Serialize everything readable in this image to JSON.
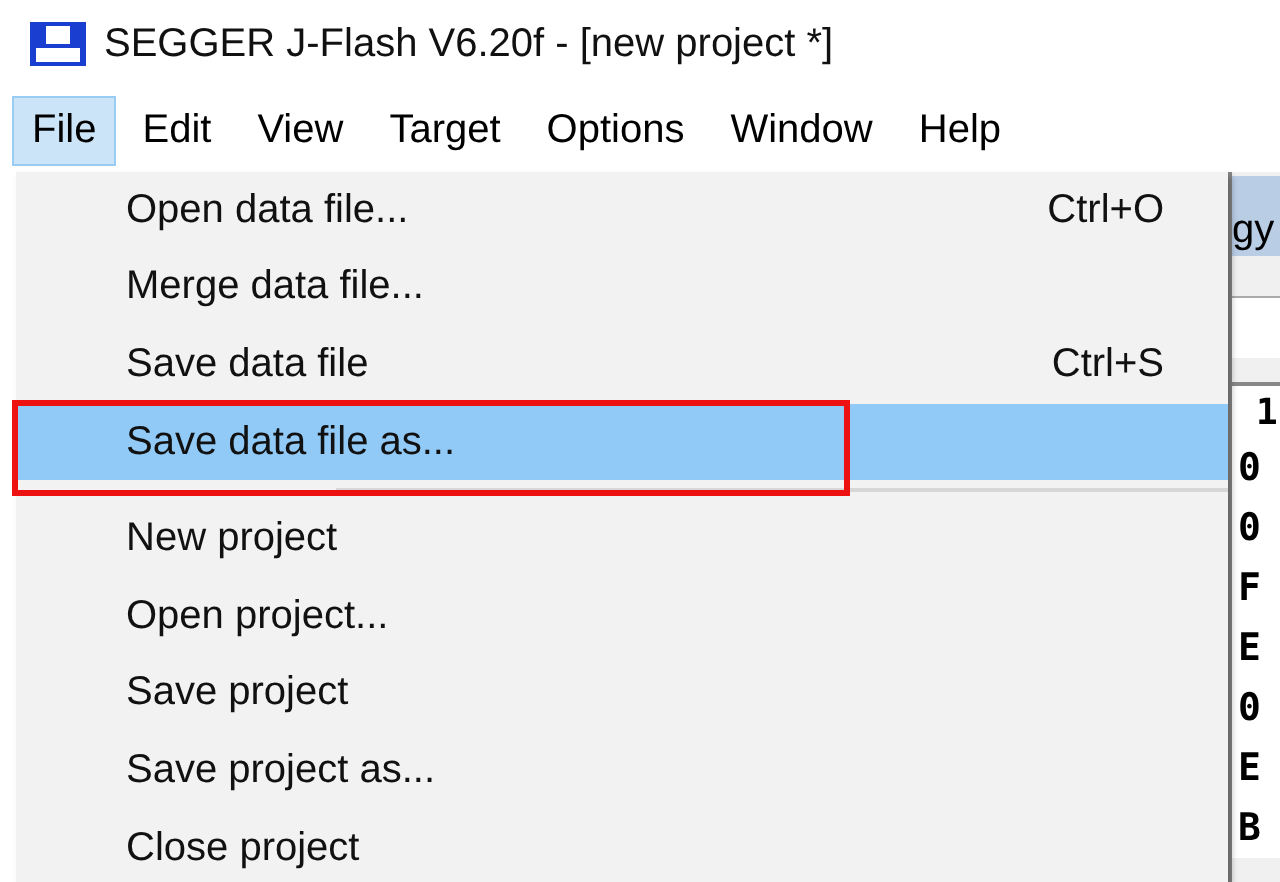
{
  "window": {
    "title": "SEGGER J-Flash V6.20f - [new project *]"
  },
  "menubar": [
    {
      "label": "File",
      "selected": true
    },
    {
      "label": "Edit",
      "selected": false
    },
    {
      "label": "View",
      "selected": false
    },
    {
      "label": "Target",
      "selected": false
    },
    {
      "label": "Options",
      "selected": false
    },
    {
      "label": "Window",
      "selected": false
    },
    {
      "label": "Help",
      "selected": false
    }
  ],
  "file_menu": [
    {
      "kind": "item",
      "label": "Open data file...",
      "shortcut": "Ctrl+O",
      "selected": false,
      "annotated": false
    },
    {
      "kind": "item",
      "label": "Merge data file...",
      "selected": false,
      "annotated": false
    },
    {
      "kind": "item",
      "label": "Save data file",
      "shortcut": "Ctrl+S",
      "selected": false,
      "annotated": false
    },
    {
      "kind": "item",
      "label": "Save data file as...",
      "selected": true,
      "annotated": true
    },
    {
      "kind": "separator"
    },
    {
      "kind": "item",
      "label": "New project",
      "selected": false,
      "annotated": false
    },
    {
      "kind": "item",
      "label": "Open project...",
      "selected": false,
      "annotated": false
    },
    {
      "kind": "item",
      "label": "Save project",
      "selected": false,
      "annotated": false
    },
    {
      "kind": "item",
      "label": "Save project as...",
      "selected": false,
      "annotated": false
    },
    {
      "kind": "item",
      "label": "Close project",
      "selected": false,
      "annotated": false
    }
  ],
  "background_window": {
    "header_text": "gy",
    "table_header": "1",
    "rows": [
      "0",
      "0",
      "F",
      "E",
      "0",
      "E",
      "B"
    ]
  }
}
